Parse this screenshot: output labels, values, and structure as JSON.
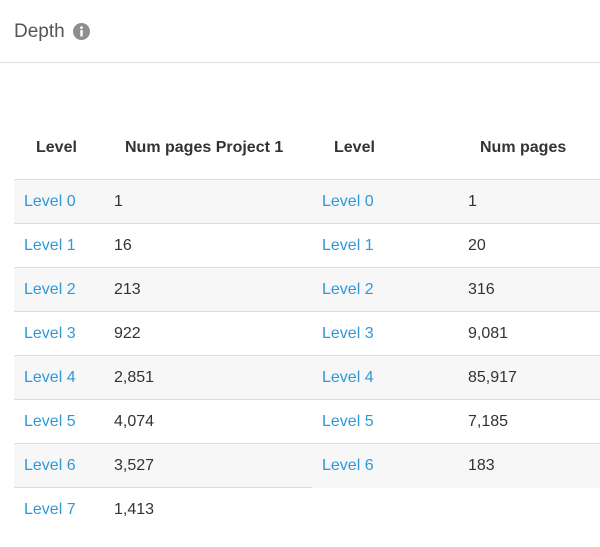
{
  "panel": {
    "title": "Depth",
    "info_icon": "info-icon"
  },
  "left_table": {
    "headers": [
      "Level",
      "Num pages Project 1"
    ],
    "rows": [
      {
        "level": "Level 0",
        "pages": "1"
      },
      {
        "level": "Level 1",
        "pages": "16"
      },
      {
        "level": "Level 2",
        "pages": "213"
      },
      {
        "level": "Level 3",
        "pages": "922"
      },
      {
        "level": "Level 4",
        "pages": "2,851"
      },
      {
        "level": "Level 5",
        "pages": "4,074"
      },
      {
        "level": "Level 6",
        "pages": "3,527"
      },
      {
        "level": "Level 7",
        "pages": "1,413"
      }
    ]
  },
  "right_table": {
    "headers": [
      "Level",
      "Num pages"
    ],
    "rows": [
      {
        "level": "Level 0",
        "pages": "1"
      },
      {
        "level": "Level 1",
        "pages": "20"
      },
      {
        "level": "Level 2",
        "pages": "316"
      },
      {
        "level": "Level 3",
        "pages": "9,081"
      },
      {
        "level": "Level 4",
        "pages": "85,917"
      },
      {
        "level": "Level 5",
        "pages": "7,185"
      },
      {
        "level": "Level 6",
        "pages": "183"
      }
    ]
  },
  "colors": {
    "link": "#2f98d8",
    "row_alt": "#f7f7f7",
    "border": "#dddddd"
  }
}
